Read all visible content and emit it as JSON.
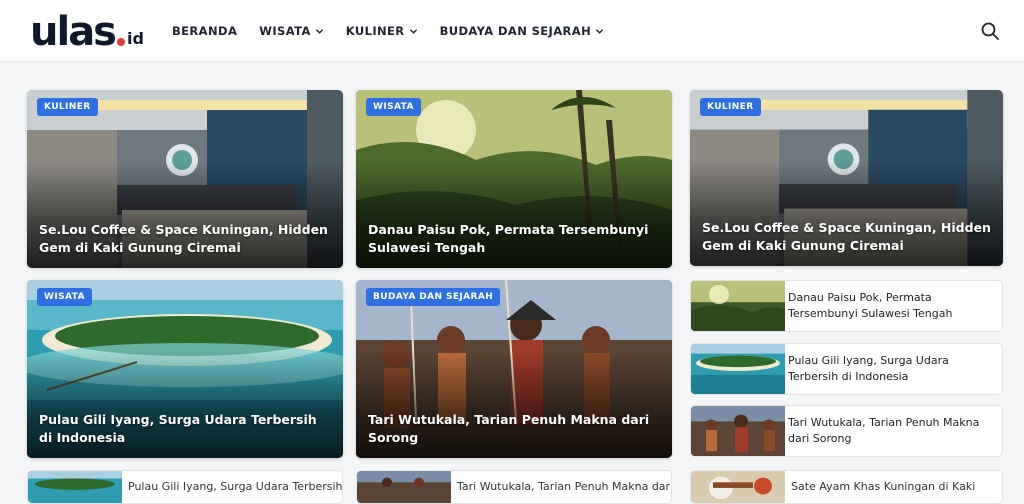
{
  "site": {
    "logo_main": "ulas",
    "logo_tld": "id"
  },
  "nav": [
    {
      "label": "BERANDA",
      "dropdown": false
    },
    {
      "label": "WISATA",
      "dropdown": true
    },
    {
      "label": "KULINER",
      "dropdown": true
    },
    {
      "label": "BUDAYA DAN SEJARAH",
      "dropdown": true
    }
  ],
  "icons": {
    "search": "search-icon",
    "dropdown": "chevron-down-icon"
  },
  "colors": {
    "badge": "#2f6fe0",
    "logo_accent": "#e23b3b",
    "text_dark": "#1e2430"
  },
  "featured": [
    {
      "category": "KULINER",
      "title": "Se.Lou Coffee & Space Kuningan, Hidden Gem di Kaki Gunung Ciremai"
    },
    {
      "category": "WISATA",
      "title": "Danau Paisu Pok, Permata Tersembunyi Sulawesi Tengah"
    },
    {
      "category": "KULINER",
      "title": "Se.Lou Coffee & Space Kuningan, Hidden Gem di Kaki Gunung Ciremai"
    },
    {
      "category": "WISATA",
      "title": "Pulau Gili Iyang, Surga Udara Terbersih di Indonesia"
    },
    {
      "category": "BUDAYA DAN SEJARAH",
      "title": "Tari Wutukala, Tarian Penuh Makna dari Sorong"
    }
  ],
  "sidebar": [
    {
      "title": "Danau Paisu Pok, Permata Tersembunyi Sulawesi Tengah"
    },
    {
      "title": "Pulau Gili Iyang, Surga Udara Terbersih di Indonesia"
    },
    {
      "title": "Tari Wutukala, Tarian Penuh Makna dari Sorong"
    }
  ],
  "bottom_row": [
    {
      "title": "Pulau Gili Iyang, Surga Udara Terbersih di"
    },
    {
      "title": "Tari Wutukala, Tarian Penuh Makna dari"
    },
    {
      "title": "Sate Ayam Khas Kuningan di Kaki"
    }
  ]
}
